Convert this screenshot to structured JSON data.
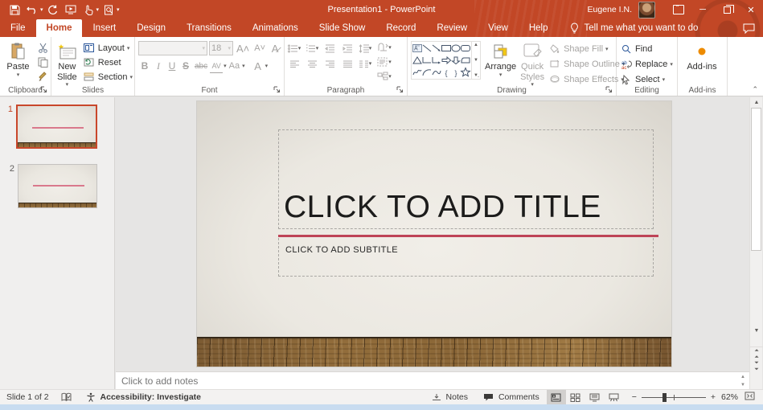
{
  "titlebar": {
    "title": "Presentation1 - PowerPoint",
    "user": "Eugene I.N."
  },
  "tabs": {
    "items": [
      {
        "label": "File"
      },
      {
        "label": "Home"
      },
      {
        "label": "Insert"
      },
      {
        "label": "Design"
      },
      {
        "label": "Transitions"
      },
      {
        "label": "Animations"
      },
      {
        "label": "Slide Show"
      },
      {
        "label": "Record"
      },
      {
        "label": "Review"
      },
      {
        "label": "View"
      },
      {
        "label": "Help"
      }
    ],
    "tell_me": "Tell me what you want to do"
  },
  "ribbon": {
    "clipboard": {
      "label": "Clipboard",
      "paste": "Paste"
    },
    "slides": {
      "label": "Slides",
      "new_slide": "New Slide",
      "layout": "Layout",
      "reset": "Reset",
      "section": "Section"
    },
    "font": {
      "label": "Font",
      "font_name": "",
      "font_size": "18",
      "bold": "B",
      "italic": "I",
      "underline": "U",
      "strike": "S",
      "strike_abc": "abc",
      "char_spacing": "AV",
      "change_case": "Aa",
      "font_color": "A"
    },
    "paragraph": {
      "label": "Paragraph"
    },
    "drawing": {
      "label": "Drawing",
      "arrange": "Arrange",
      "quick_styles": "Quick Styles",
      "shape_fill": "Shape Fill",
      "shape_outline": "Shape Outline",
      "shape_effects": "Shape Effects"
    },
    "editing": {
      "label": "Editing",
      "find": "Find",
      "replace": "Replace",
      "select": "Select"
    },
    "addins": {
      "label": "Add-ins",
      "button": "Add-ins"
    }
  },
  "thumbnails": [
    {
      "number": "1"
    },
    {
      "number": "2"
    }
  ],
  "slide": {
    "title_placeholder": "CLICK TO ADD TITLE",
    "subtitle_placeholder": "CLICK TO ADD SUBTITLE"
  },
  "notes": {
    "placeholder": "Click to add notes"
  },
  "statusbar": {
    "slide_indicator": "Slide 1 of 2",
    "accessibility": "Accessibility: Investigate",
    "notes_label": "Notes",
    "comments_label": "Comments",
    "zoom_out": "−",
    "zoom_in": "+",
    "zoom_pct": "62%"
  },
  "colors": {
    "brand": "#C24726",
    "accent_line": "#BE4457",
    "selection_border": "#C9472B",
    "disabled": "#A6A4A2"
  }
}
